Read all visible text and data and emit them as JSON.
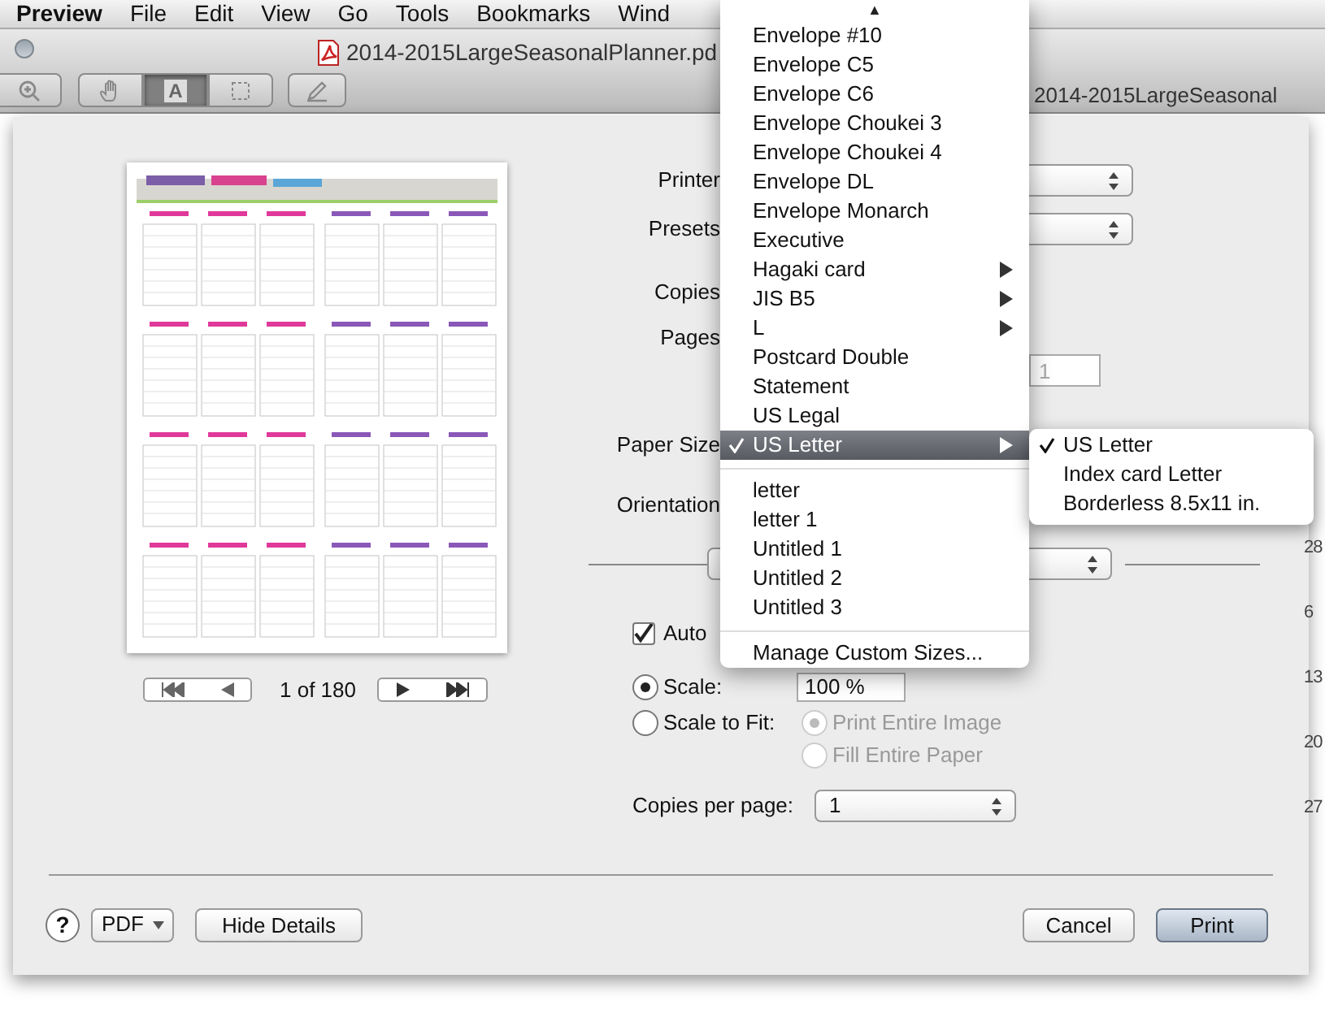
{
  "menu_bar": {
    "app_name": "Preview",
    "items": [
      "File",
      "Edit",
      "View",
      "Go",
      "Tools",
      "Bookmarks",
      "Wind"
    ]
  },
  "window": {
    "title": "2014-2015LargeSeasonalPlanner.pd"
  },
  "background_window": {
    "title": "2014-2015LargeSeasonal"
  },
  "toolbar": {
    "tools": [
      {
        "kind": "zoom-in",
        "selected": false
      },
      {
        "kind": "hand",
        "selected": false
      },
      {
        "kind": "text",
        "glyph": "A",
        "selected": true
      },
      {
        "kind": "select",
        "selected": false
      },
      {
        "kind": "annotate",
        "selected": false
      }
    ]
  },
  "print_dialog": {
    "labels": [
      "Printer",
      "Presets",
      "Copies",
      "Pages",
      "Paper Size",
      "Orientation"
    ],
    "pages_to": {
      "placeholder": "1"
    },
    "pager": {
      "text": "1 of 180"
    },
    "auto_rotate": {
      "label": "Auto",
      "checked": true
    },
    "scale": {
      "label": "Scale:",
      "selected": true,
      "value": "100 %"
    },
    "scale_to_fit": {
      "label": "Scale to Fit:",
      "selected": false,
      "options": [
        {
          "label": "Print Entire Image",
          "selected": true
        },
        {
          "label": "Fill Entire Paper",
          "selected": false
        }
      ]
    },
    "copies_per_page": {
      "label": "Copies per page:",
      "value": "1"
    },
    "help_button": "?",
    "pdf_button": "PDF",
    "details_button": "Hide Details",
    "cancel_button": "Cancel",
    "print_button": "Print"
  },
  "paper_size_menu": {
    "scroll_arrow": "▲",
    "items": [
      {
        "kind": "item",
        "label": "Envelope #10",
        "selected": false,
        "submenu": false
      },
      {
        "kind": "item",
        "label": "Envelope C5",
        "selected": false,
        "submenu": false
      },
      {
        "kind": "item",
        "label": "Envelope C6",
        "selected": false,
        "submenu": false
      },
      {
        "kind": "item",
        "label": "Envelope Choukei 3",
        "selected": false,
        "submenu": false
      },
      {
        "kind": "item",
        "label": "Envelope Choukei 4",
        "selected": false,
        "submenu": false
      },
      {
        "kind": "item",
        "label": "Envelope DL",
        "selected": false,
        "submenu": false
      },
      {
        "kind": "item",
        "label": "Envelope Monarch",
        "selected": false,
        "submenu": false
      },
      {
        "kind": "item",
        "label": "Executive",
        "selected": false,
        "submenu": false
      },
      {
        "kind": "item",
        "label": "Hagaki card",
        "selected": false,
        "submenu": true
      },
      {
        "kind": "item",
        "label": "JIS B5",
        "selected": false,
        "submenu": true
      },
      {
        "kind": "item",
        "label": "L",
        "selected": false,
        "submenu": true
      },
      {
        "kind": "item",
        "label": "Postcard Double",
        "selected": false,
        "submenu": false
      },
      {
        "kind": "item",
        "label": "Statement",
        "selected": false,
        "submenu": false
      },
      {
        "kind": "item",
        "label": "US Legal",
        "selected": false,
        "submenu": false
      },
      {
        "kind": "item",
        "label": "US Letter",
        "selected": true,
        "submenu": true
      },
      {
        "kind": "separator"
      },
      {
        "kind": "item",
        "label": "letter",
        "selected": false,
        "submenu": false
      },
      {
        "kind": "item",
        "label": "letter 1",
        "selected": false,
        "submenu": false
      },
      {
        "kind": "item",
        "label": "Untitled 1",
        "selected": false,
        "submenu": false
      },
      {
        "kind": "item",
        "label": "Untitled 2",
        "selected": false,
        "submenu": false
      },
      {
        "kind": "item",
        "label": "Untitled 3",
        "selected": false,
        "submenu": false
      },
      {
        "kind": "separator"
      },
      {
        "kind": "item",
        "label": "Manage Custom Sizes...",
        "selected": false,
        "submenu": false
      }
    ]
  },
  "submenu": {
    "items": [
      {
        "label": "US Letter",
        "selected": true
      },
      {
        "label": "Index card Letter",
        "selected": false
      },
      {
        "label": "Borderless 8.5x11 in.",
        "selected": false
      }
    ]
  },
  "right_edge_numbers": [
    "28",
    "6",
    "13",
    "20",
    "27"
  ]
}
